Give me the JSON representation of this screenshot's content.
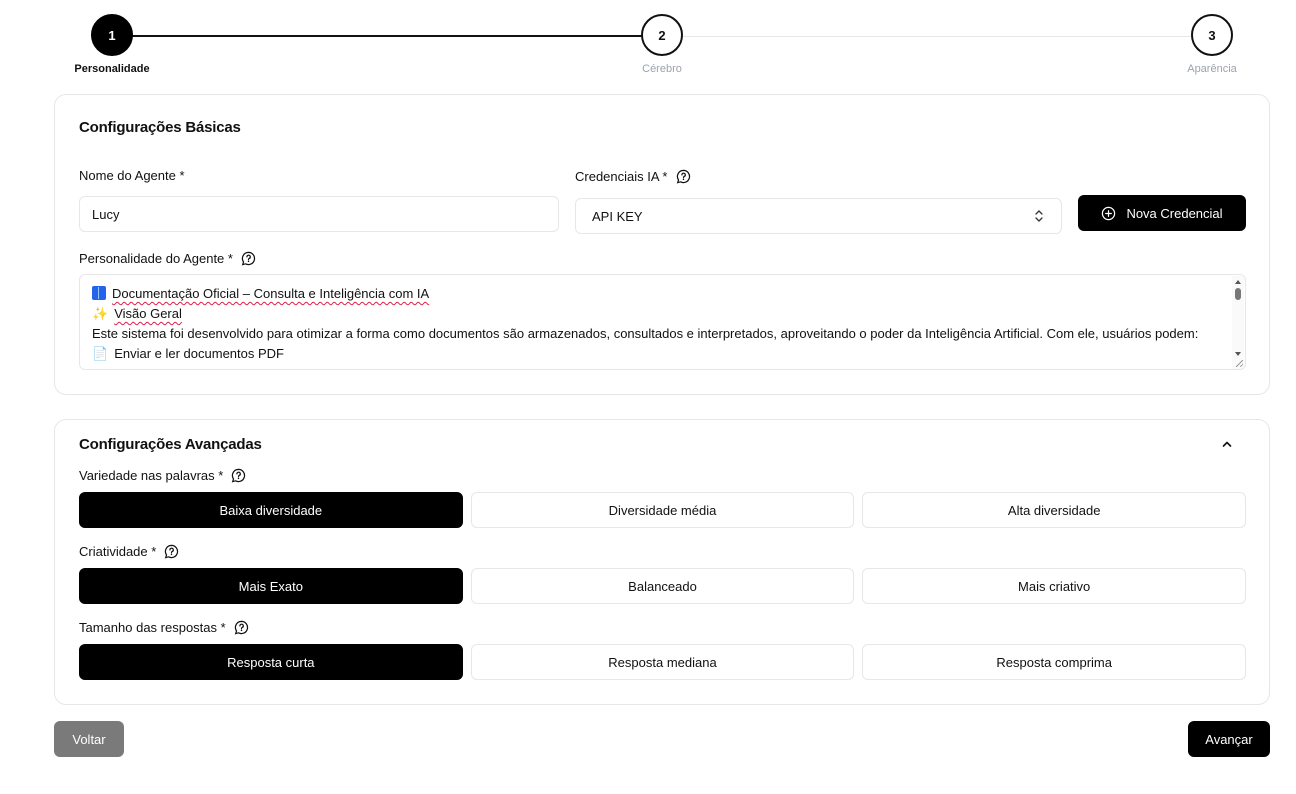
{
  "stepper": {
    "steps": [
      {
        "number": "1",
        "label": "Personalidade",
        "state": "active"
      },
      {
        "number": "2",
        "label": "Cérebro",
        "state": "inactive"
      },
      {
        "number": "3",
        "label": "Aparência",
        "state": "inactive"
      }
    ]
  },
  "basic": {
    "title": "Configurações Básicas",
    "agent_name_label": "Nome do Agente *",
    "agent_name_value": "Lucy",
    "credentials_label": "Credenciais IA *",
    "credentials_value": "API KEY",
    "new_credential_label": "Nova Credencial",
    "personality_label": "Personalidade do Agente *",
    "personality_text": {
      "line1": "Documentação Oficial – Consulta e Inteligência com IA",
      "line2": "Visão Geral",
      "line3": "Este sistema foi desenvolvido para otimizar a forma como documentos são armazenados, consultados e interpretados, aproveitando o poder da Inteligência Artificial. Com ele, usuários podem:",
      "line4": "Enviar e ler documentos PDF"
    }
  },
  "advanced": {
    "title": "Configurações Avançadas",
    "word_variety": {
      "label": "Variedade nas palavras *",
      "options": [
        "Baixa diversidade",
        "Diversidade média",
        "Alta diversidade"
      ],
      "selected": 0
    },
    "creativity": {
      "label": "Criatividade *",
      "options": [
        "Mais Exato",
        "Balanceado",
        "Mais criativo"
      ],
      "selected": 0
    },
    "response_size": {
      "label": "Tamanho das respostas *",
      "options": [
        "Resposta curta",
        "Resposta mediana",
        "Resposta comprima"
      ],
      "selected": 0
    }
  },
  "footer": {
    "back_label": "Voltar",
    "next_label": "Avançar"
  }
}
